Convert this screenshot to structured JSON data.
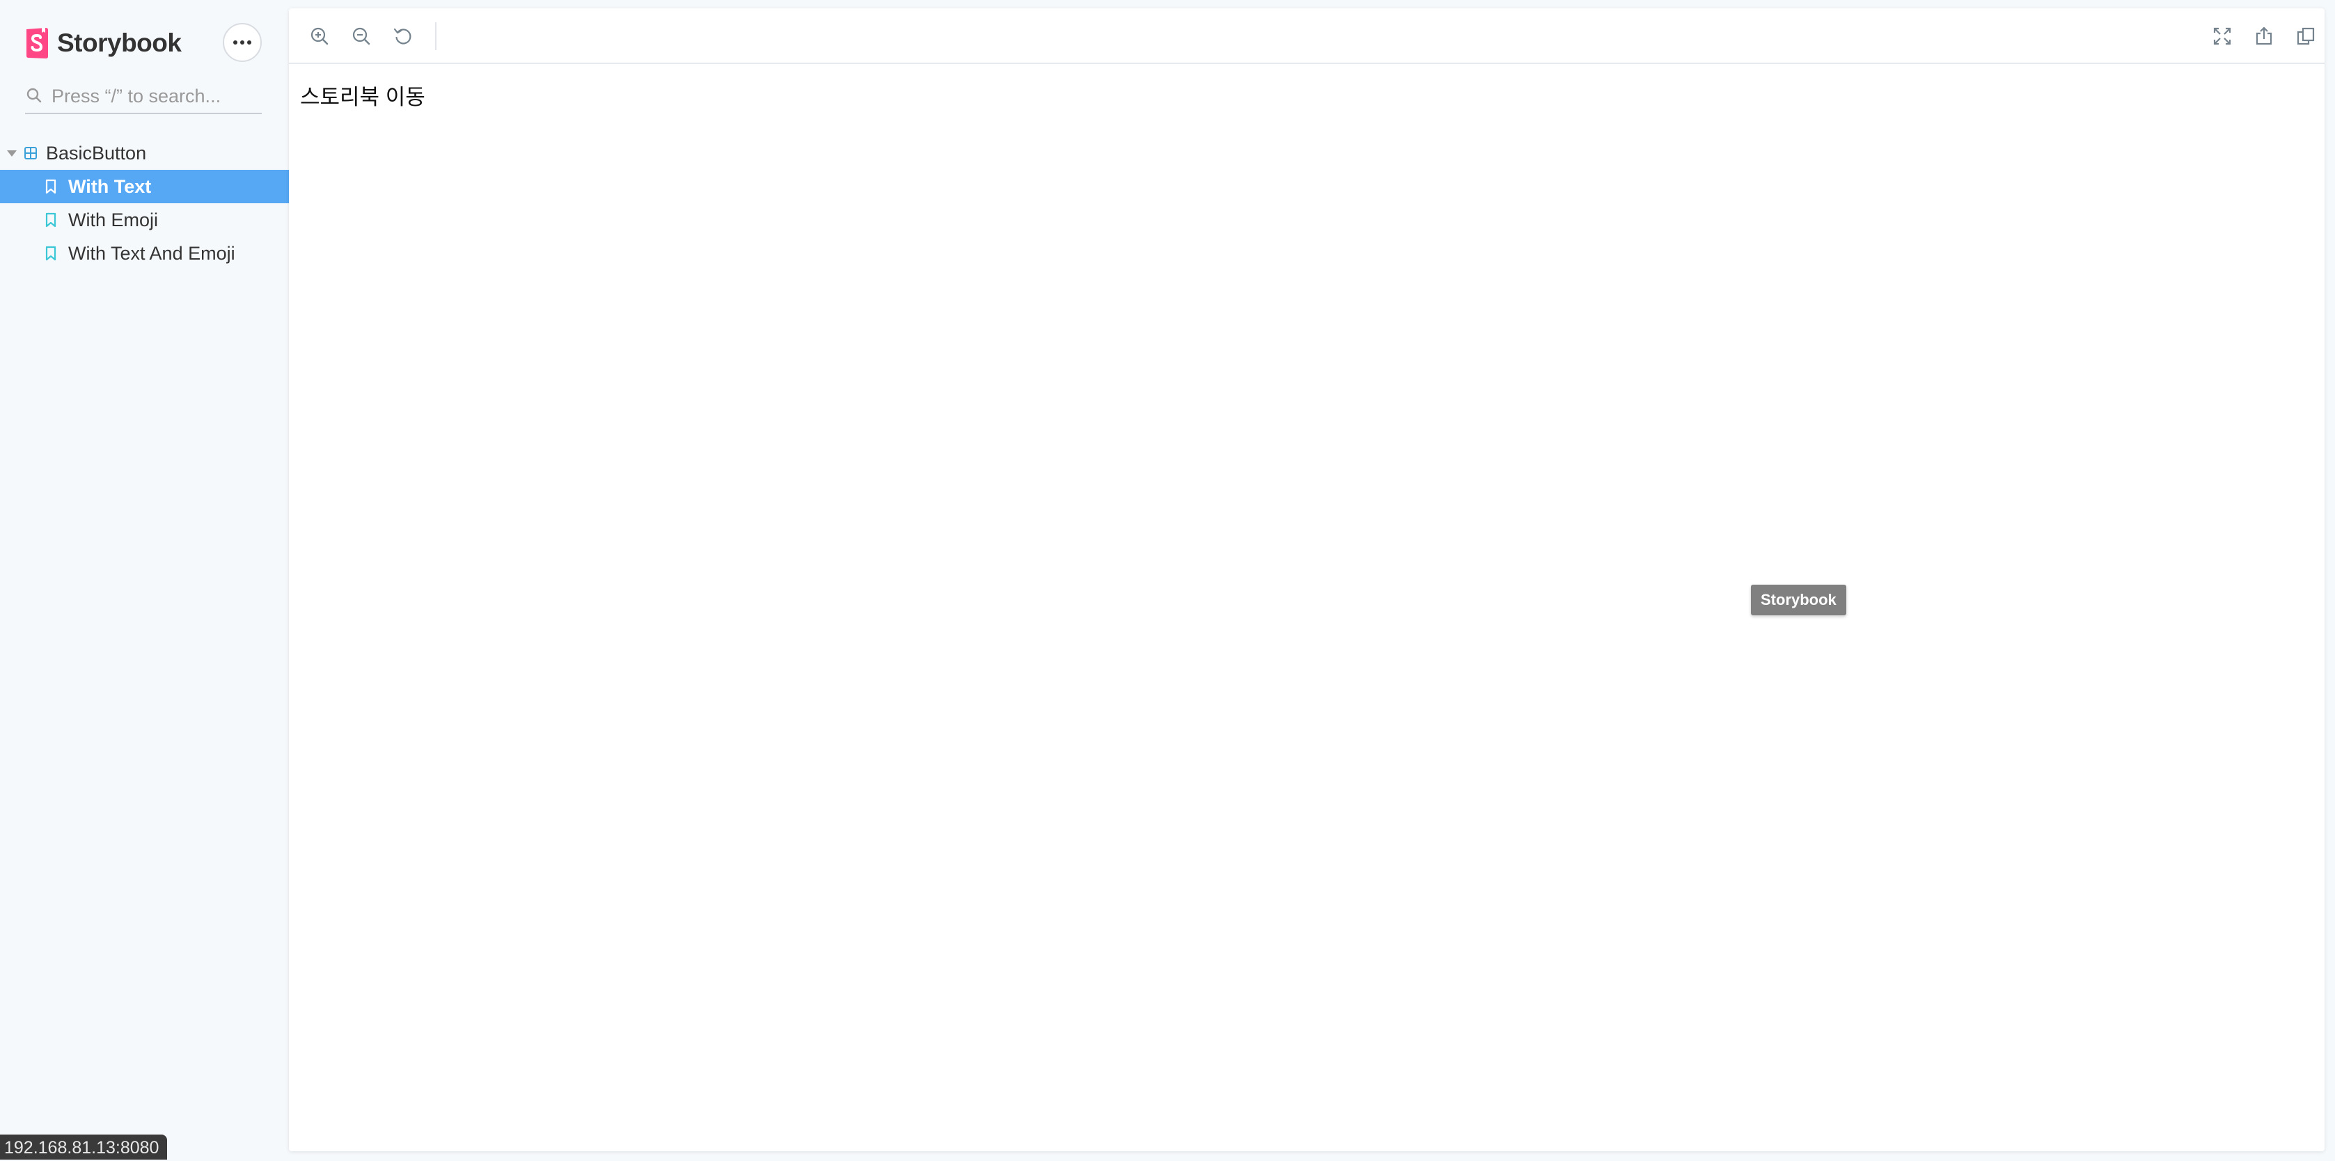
{
  "brand": {
    "name": "Storybook",
    "logo_icon": "storybook-logo-icon",
    "accent": "#FF4785"
  },
  "sidebar": {
    "menu_icon": "ellipsis-icon",
    "search": {
      "placeholder": "Press “/” to search...",
      "value": ""
    },
    "tree": {
      "component": {
        "label": "BasicButton",
        "icon": "component-icon",
        "expanded": true
      },
      "stories": [
        {
          "label": "With Text",
          "icon": "bookmark-icon",
          "selected": true
        },
        {
          "label": "With Emoji",
          "icon": "bookmark-icon",
          "selected": false
        },
        {
          "label": "With Text And Emoji",
          "icon": "bookmark-icon",
          "selected": false
        }
      ]
    }
  },
  "toolbar": {
    "left_icons": [
      "zoom-in-icon",
      "zoom-out-icon",
      "reset-zoom-icon"
    ],
    "right_icons": [
      "fullscreen-icon",
      "share-icon",
      "copy-link-icon"
    ]
  },
  "preview": {
    "content_text": "스토리북 이동",
    "tooltip": "Storybook"
  },
  "status_bar": {
    "url": "192.168.81.13:8080"
  },
  "colors": {
    "selected_bg": "#56A8F5",
    "sidebar_bg": "#F6F9FC",
    "story_icon": "#3BC7D6"
  }
}
